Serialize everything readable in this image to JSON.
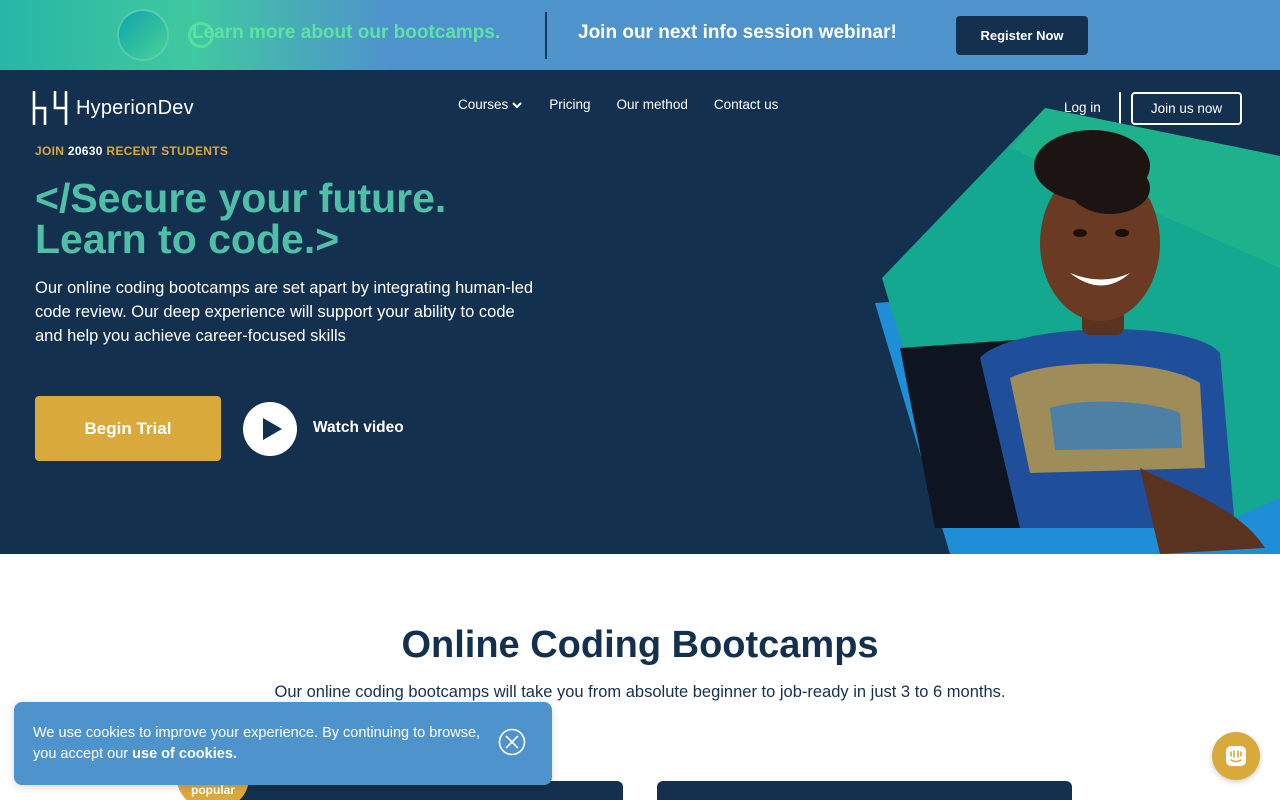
{
  "promo": {
    "learn_more": "Learn more about our bootcamps.",
    "webinar": "Join our next info session webinar!",
    "register": "Register Now"
  },
  "header": {
    "brand": "HyperionDev",
    "nav": {
      "courses": "Courses",
      "pricing": "Pricing",
      "method": "Our method",
      "contact": "Contact us"
    },
    "login": "Log in",
    "join": "Join us now"
  },
  "hero": {
    "eyebrow_prefix": "JOIN ",
    "eyebrow_count": "20630",
    "eyebrow_suffix": " RECENT STUDENTS",
    "headline_line1": "</Secure your future.",
    "headline_line2": "Learn to code.>",
    "subcopy": "Our online coding bootcamps are set apart by integrating human-led code review. Our deep experience will support your ability to code and help you achieve career-focused skills",
    "trial": "Begin Trial",
    "watch": "Watch video"
  },
  "section": {
    "title": "Online Coding Bootcamps",
    "subtitle": "Our online coding bootcamps will take you from absolute beginner to job-ready in just 3 to 6 months.",
    "badge": "popular"
  },
  "cookie": {
    "text": "We use cookies to improve your experience. By continuing to browse, you accept our ",
    "link": "use of cookies."
  },
  "colors": {
    "navy": "#14304f",
    "gold": "#d9a93c",
    "teal": "#4fbfa8",
    "blue": "#4f93cc"
  },
  "icons": [
    "logo-icon",
    "chevron-down-icon",
    "play-icon",
    "close-icon",
    "chat-icon"
  ]
}
